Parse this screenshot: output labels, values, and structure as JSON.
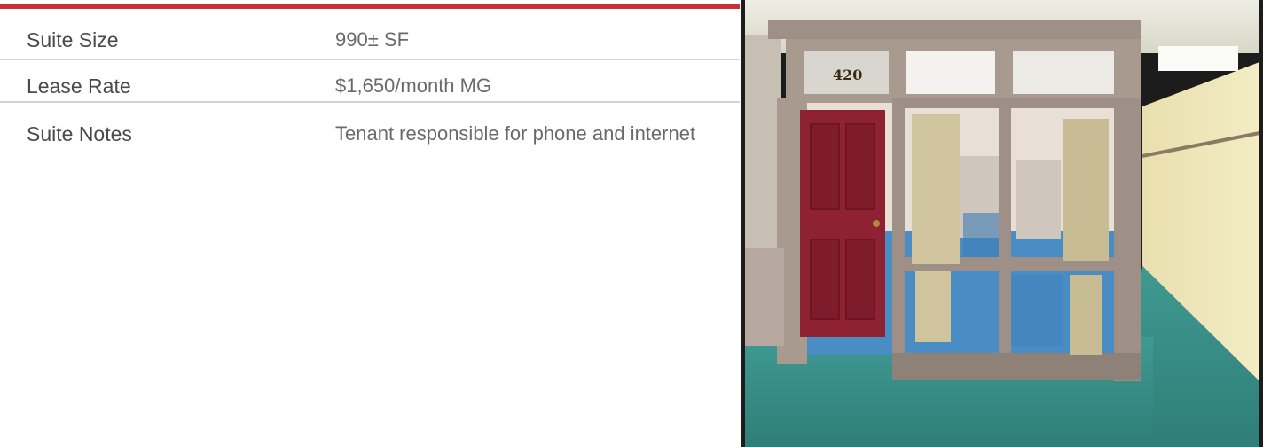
{
  "colors": {
    "accent": "#c8303a",
    "label_text": "#4a4a4a",
    "value_text": "#6a6a6a",
    "divider": "#d2d2d2"
  },
  "details": [
    {
      "label": "Suite Size",
      "value": "990± SF"
    },
    {
      "label": "Lease Rate",
      "value": "$1,650/month MG"
    },
    {
      "label": "Suite Notes",
      "value": "Tenant responsible for phone and internet"
    }
  ],
  "photo": {
    "subject": "office-suite-entrance",
    "suite_number_sign": "420"
  }
}
